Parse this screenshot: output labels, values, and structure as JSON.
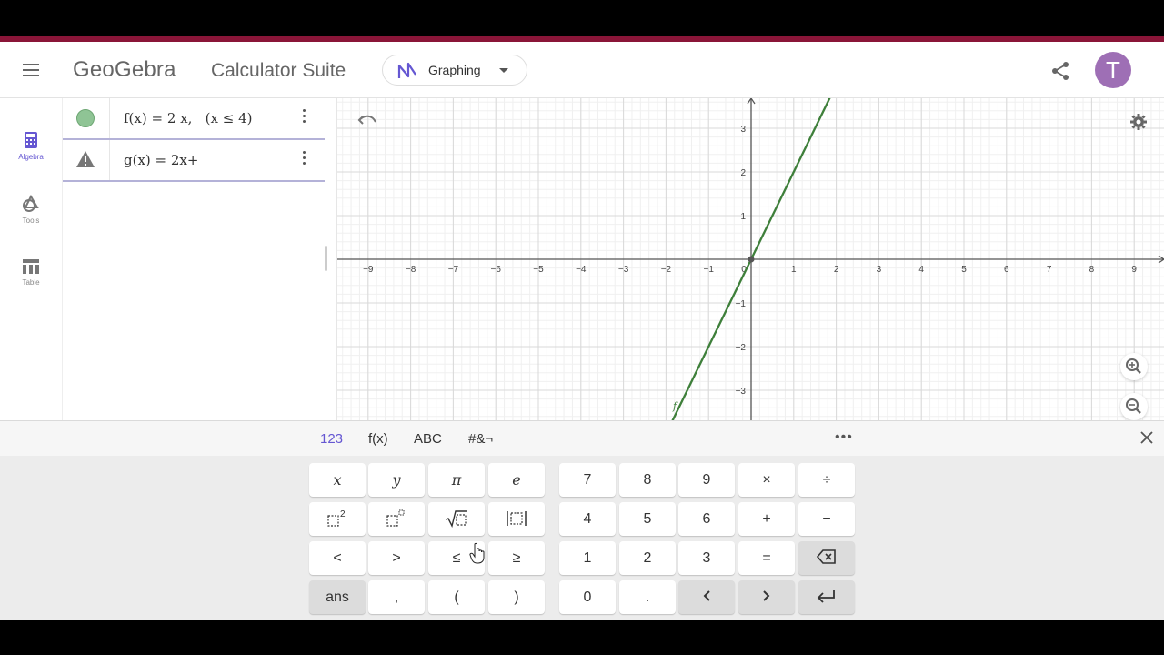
{
  "header": {
    "logo": "GeoGebra",
    "suite": "Calculator Suite",
    "app_picker_label": "Graphing",
    "avatar_letter": "T"
  },
  "sidebar": {
    "items": [
      {
        "label": "Algebra",
        "icon": "calculator-icon"
      },
      {
        "label": "Tools",
        "icon": "tools-icon"
      },
      {
        "label": "Table",
        "icon": "table-icon"
      }
    ]
  },
  "algebra": {
    "rows": [
      {
        "expr": "f(x) = 2 x,   (x ≤ 4)",
        "marker": "visibility-dot",
        "color": "#8fc495"
      },
      {
        "expr": "g(x) = 2x+",
        "marker": "warning-icon"
      }
    ]
  },
  "graph": {
    "x_ticks": [
      "-9",
      "-8",
      "-7",
      "-6",
      "-5",
      "-4",
      "-3",
      "-2",
      "-1",
      "0",
      "1",
      "2",
      "3",
      "4",
      "5",
      "6",
      "7",
      "8",
      "9"
    ],
    "y_ticks_pos": [
      "3",
      "2",
      "1"
    ],
    "y_ticks_neg": [
      "-1",
      "-2",
      "-3"
    ],
    "curve_color": "#3e7f3a",
    "segment_label": "f"
  },
  "keyboard": {
    "tabs": [
      "123",
      "f(x)",
      "ABC",
      "#&¬"
    ],
    "more": "•••",
    "left_keys": [
      [
        "x",
        "y",
        "π",
        "e"
      ],
      [
        "square",
        "power",
        "sqrt",
        "abs"
      ],
      [
        "<",
        ">",
        "≤",
        "≥"
      ],
      [
        "ans",
        ",",
        "(",
        ")"
      ]
    ],
    "right_keys": [
      [
        "7",
        "8",
        "9",
        "×",
        "÷"
      ],
      [
        "4",
        "5",
        "6",
        "+",
        "−"
      ],
      [
        "1",
        "2",
        "3",
        "=",
        "backspace"
      ],
      [
        "0",
        ".",
        "<",
        ">",
        "enter"
      ]
    ]
  }
}
